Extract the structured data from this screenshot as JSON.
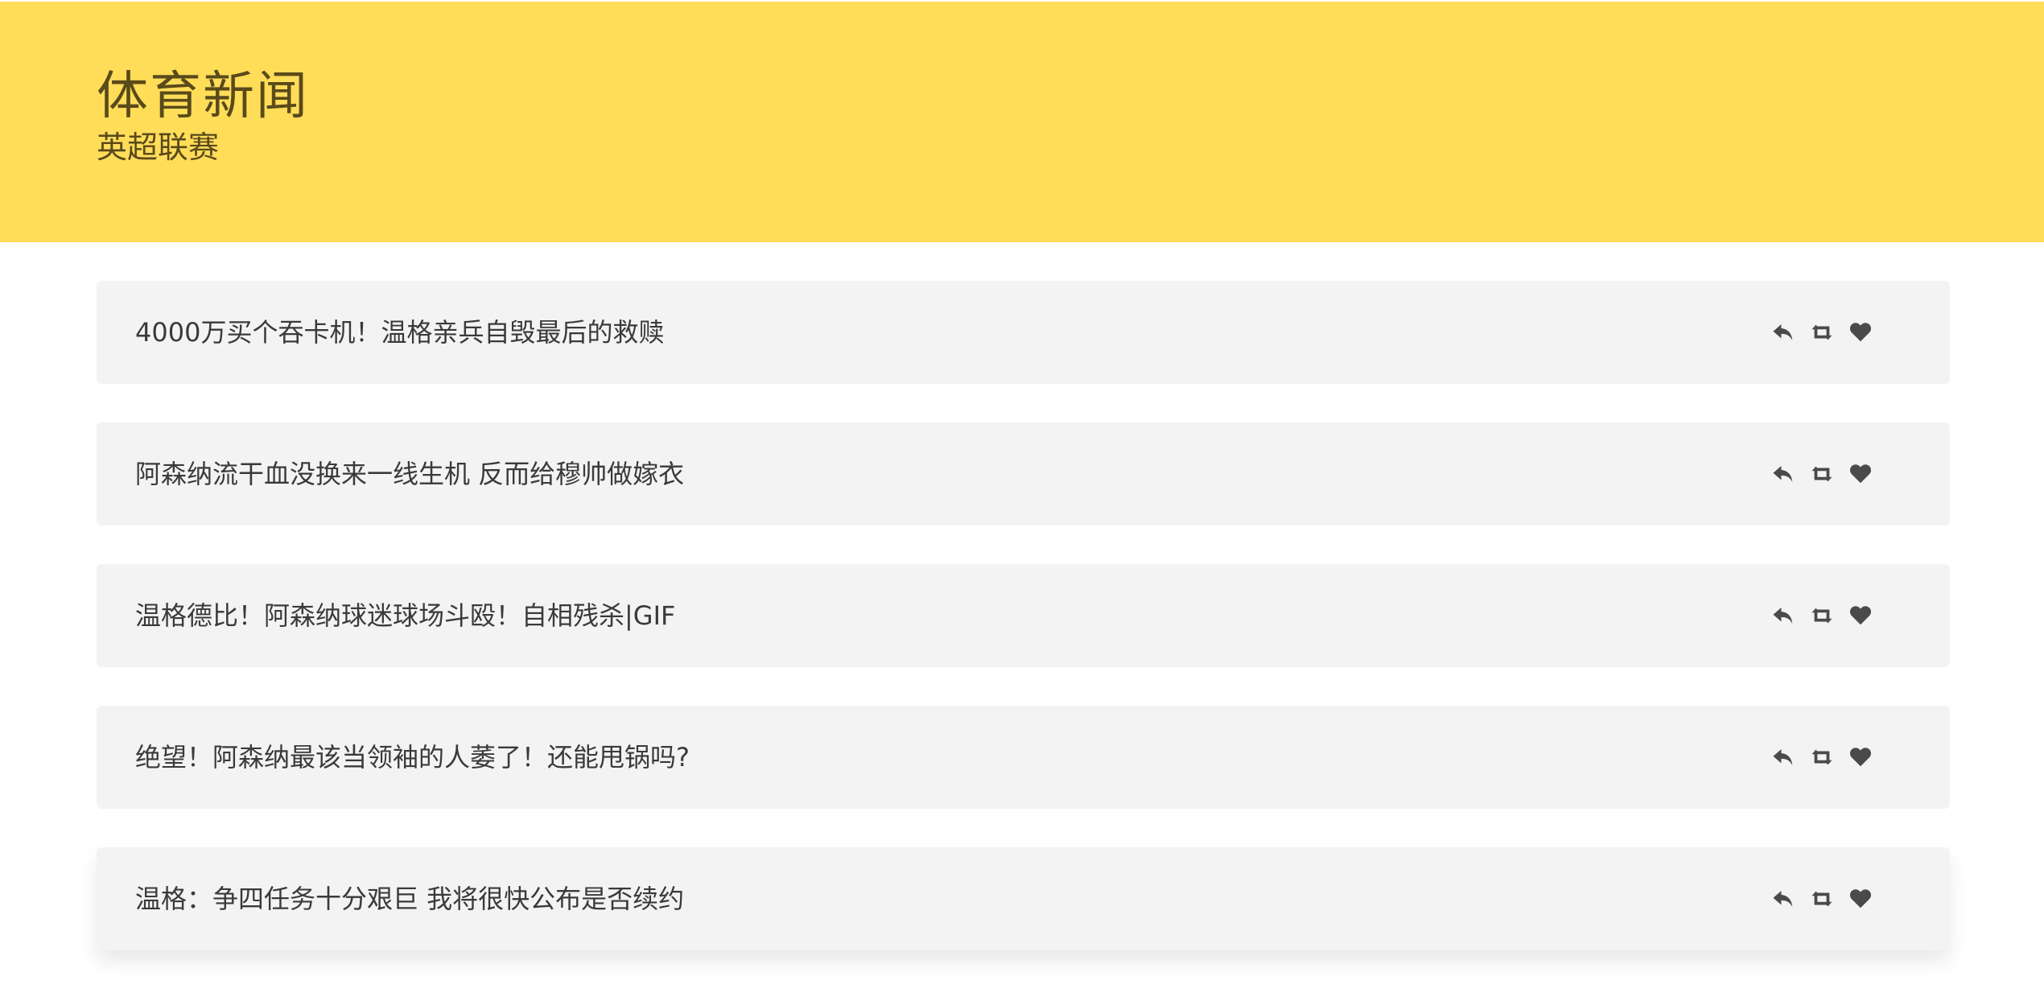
{
  "header": {
    "title": "体育新闻",
    "subtitle": "英超联赛"
  },
  "news": [
    {
      "title": "4000万买个吞卡机！温格亲兵自毁最后的救赎"
    },
    {
      "title": "阿森纳流干血没换来一线生机 反而给穆帅做嫁衣"
    },
    {
      "title": "温格德比！阿森纳球迷球场斗殴！自相残杀|GIF"
    },
    {
      "title": "绝望！阿森纳最该当领袖的人萎了！还能甩锅吗?"
    },
    {
      "title": "温格：争四任务十分艰巨 我将很快公布是否续约"
    }
  ],
  "icons": {
    "reply": "reply-icon",
    "retweet": "retweet-icon",
    "like": "heart-icon"
  },
  "colors": {
    "header_bg": "#ffdd59",
    "card_bg": "#f3f3f3",
    "text": "#3a3a3a",
    "icon": "#4a4a4a"
  }
}
